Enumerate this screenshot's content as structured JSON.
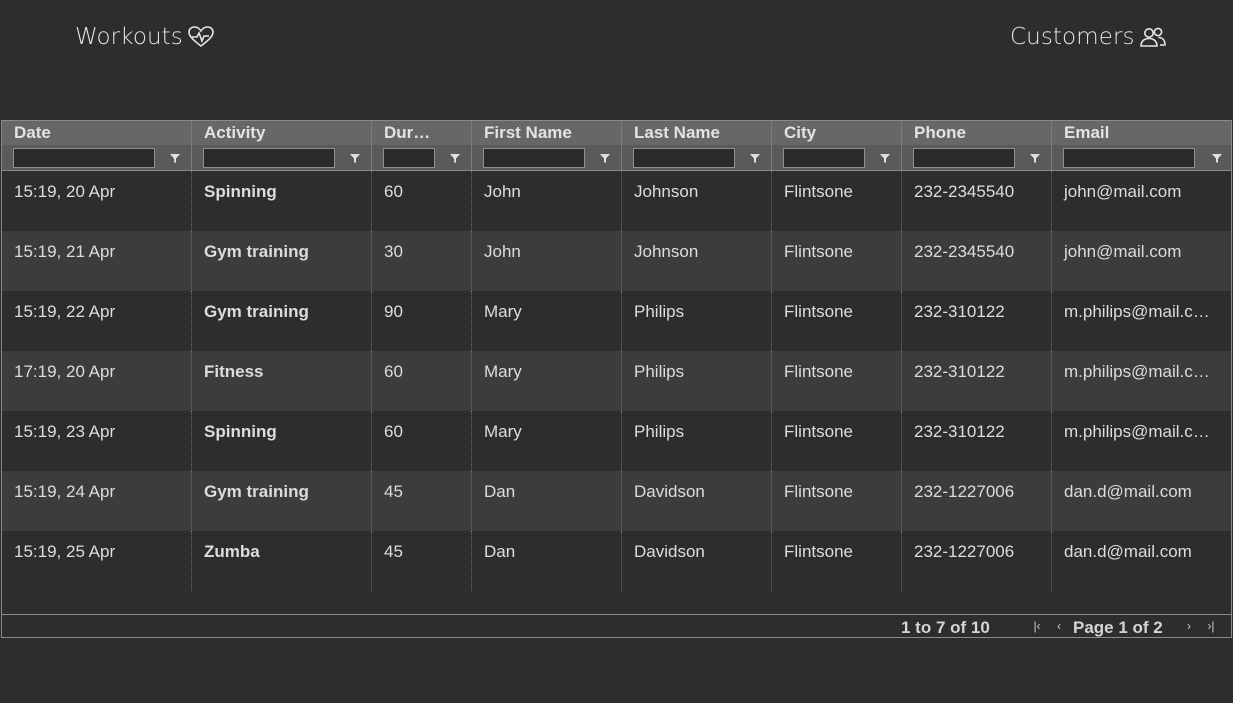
{
  "nav": {
    "workouts_label": "Workouts",
    "customers_label": "Customers"
  },
  "columns": [
    "Date",
    "Activity",
    "Dur…",
    "First Name",
    "Last Name",
    "City",
    "Phone",
    "Email"
  ],
  "rows": [
    {
      "date": "15:19, 20 Apr",
      "activity": "Spinning",
      "duration": "60",
      "first_name": "John",
      "last_name": "Johnson",
      "city": "Flintsone",
      "phone": "232-2345540",
      "email": "john@mail.com"
    },
    {
      "date": "15:19, 21 Apr",
      "activity": "Gym training",
      "duration": "30",
      "first_name": "John",
      "last_name": "Johnson",
      "city": "Flintsone",
      "phone": "232-2345540",
      "email": "john@mail.com"
    },
    {
      "date": "15:19, 22 Apr",
      "activity": "Gym training",
      "duration": "90",
      "first_name": "Mary",
      "last_name": "Philips",
      "city": "Flintsone",
      "phone": "232-310122",
      "email": "m.philips@mail.c…"
    },
    {
      "date": "17:19, 20 Apr",
      "activity": "Fitness",
      "duration": "60",
      "first_name": "Mary",
      "last_name": "Philips",
      "city": "Flintsone",
      "phone": "232-310122",
      "email": "m.philips@mail.c…"
    },
    {
      "date": "15:19, 23 Apr",
      "activity": "Spinning",
      "duration": "60",
      "first_name": "Mary",
      "last_name": "Philips",
      "city": "Flintsone",
      "phone": "232-310122",
      "email": "m.philips@mail.c…"
    },
    {
      "date": "15:19, 24 Apr",
      "activity": "Gym training",
      "duration": "45",
      "first_name": "Dan",
      "last_name": "Davidson",
      "city": "Flintsone",
      "phone": "232-1227006",
      "email": "dan.d@mail.com"
    },
    {
      "date": "15:19, 25 Apr",
      "activity": "Zumba",
      "duration": "45",
      "first_name": "Dan",
      "last_name": "Davidson",
      "city": "Flintsone",
      "phone": "232-1227006",
      "email": "dan.d@mail.com"
    }
  ],
  "pagination": {
    "summary": "1 to 7 of 10",
    "page_label": "Page 1 of 2",
    "first_icon": "first-page-icon",
    "prev_icon": "previous-page-icon",
    "next_icon": "next-page-icon",
    "last_icon": "last-page-icon"
  },
  "icons": {
    "workouts": "heart-pulse-icon",
    "customers": "people-icon",
    "filter": "filter-icon"
  },
  "colors": {
    "background": "#2d2c2e",
    "header": "#676767",
    "alt_row": "#3c3b3d"
  }
}
